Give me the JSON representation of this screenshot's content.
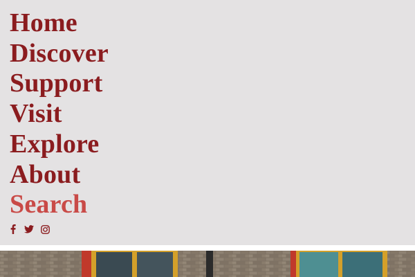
{
  "nav": {
    "items": [
      {
        "label": "Home"
      },
      {
        "label": "Discover"
      },
      {
        "label": "Support"
      },
      {
        "label": "Visit"
      },
      {
        "label": "Explore"
      },
      {
        "label": "About"
      },
      {
        "label": "Search"
      }
    ]
  },
  "social": {
    "icons": [
      "facebook-icon",
      "twitter-icon",
      "instagram-icon"
    ]
  },
  "colors": {
    "menu_background": "#e4e2e3",
    "nav_text": "#8b1c1f",
    "search_text": "#c94a47",
    "icon": "#8b1c1f"
  }
}
